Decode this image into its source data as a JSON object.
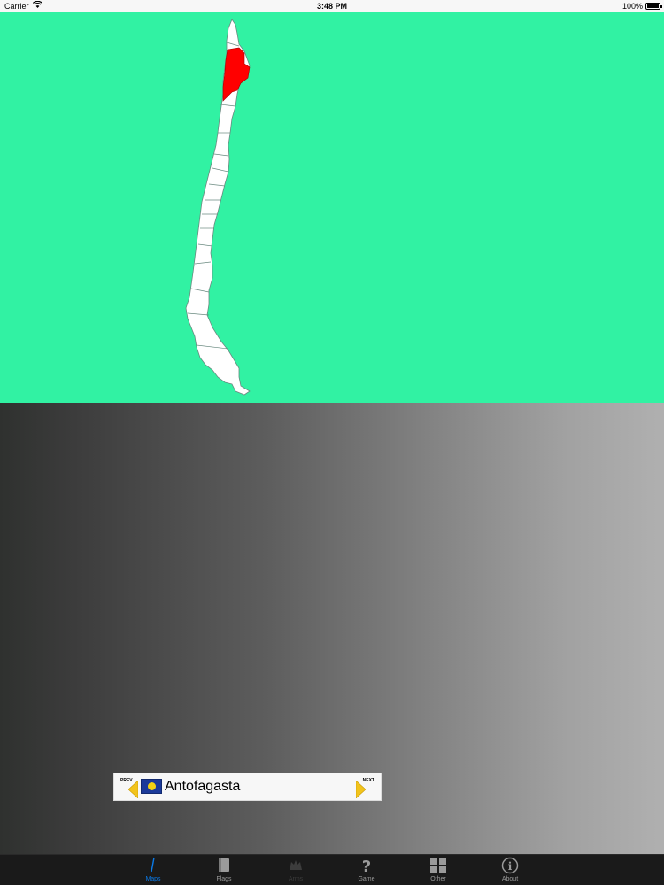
{
  "status_bar": {
    "carrier": "Carrier",
    "time": "3:48 PM",
    "battery": "100%"
  },
  "map": {
    "background_color": "#31f2a3",
    "country_fill": "#ffffff",
    "highlight_color": "#ff0000",
    "highlighted_region": "Antofagasta"
  },
  "navigator": {
    "prev_label": "PREV",
    "next_label": "NEXT",
    "region_name": "Antofagasta",
    "flag_icon": "antofagasta-flag-icon"
  },
  "tabs": [
    {
      "label": "Maps",
      "icon": "map-pin-icon",
      "active": true
    },
    {
      "label": "Flags",
      "icon": "flag-icon",
      "active": false
    },
    {
      "label": "Arms",
      "icon": "coat-of-arms-icon",
      "active": false
    },
    {
      "label": "Game",
      "icon": "question-icon",
      "active": false
    },
    {
      "label": "Other",
      "icon": "grid-icon",
      "active": false
    },
    {
      "label": "About",
      "icon": "info-icon",
      "active": false
    }
  ]
}
